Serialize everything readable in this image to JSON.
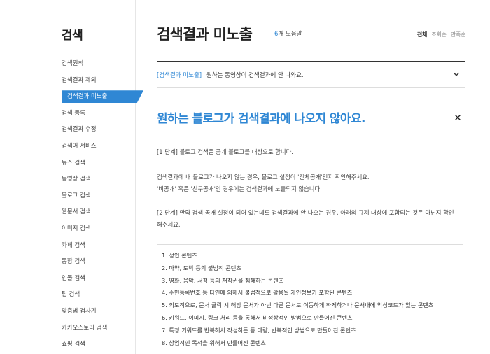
{
  "sidebar": {
    "title": "검색",
    "items": [
      {
        "label": "검색원칙",
        "active": false
      },
      {
        "label": "검색결과 제외",
        "active": false
      },
      {
        "label": "검색결과 미노출",
        "active": true
      },
      {
        "label": "검색 등록",
        "active": false
      },
      {
        "label": "검색결과 수정",
        "active": false
      },
      {
        "label": "검색어 서비스",
        "active": false
      },
      {
        "label": "뉴스 검색",
        "active": false
      },
      {
        "label": "동영상 검색",
        "active": false
      },
      {
        "label": "블로그 검색",
        "active": false
      },
      {
        "label": "웹문서 검색",
        "active": false
      },
      {
        "label": "이미지 검색",
        "active": false
      },
      {
        "label": "카페 검색",
        "active": false
      },
      {
        "label": "통합 검색",
        "active": false
      },
      {
        "label": "인물 검색",
        "active": false
      },
      {
        "label": "팁 검색",
        "active": false
      },
      {
        "label": "맞춤법 검사기",
        "active": false
      },
      {
        "label": "카카오스토리 검색",
        "active": false
      },
      {
        "label": "쇼핑 검색",
        "active": false
      }
    ]
  },
  "header": {
    "title": "검색결과 미노출",
    "help_count": "6",
    "help_suffix": "개 도움말",
    "sort": [
      "전체",
      "조회순",
      "만족순"
    ]
  },
  "faq": {
    "category": "[검색결과 미노출]",
    "question": "원하는 동영상이 검색결과에 안 나와요."
  },
  "answer": {
    "title": "원하는 블로그가 검색결과에 나오지 않아요.",
    "p1": "[1 단계] 블로그 검색은 공개 블로그를 대상으로 합니다.",
    "p2a": "검색결과에 내 블로그가 나오지 않는 경우, 블로그 설정이 '전체공개'인지 확인해주세요.",
    "p2b": "'비공개' 혹은 '친구공개'인 경우에는 검색결과에 노출되지 않습니다.",
    "p3a": "[2 단계] 만약 검색 공개 설정이 되어 있는데도 검색결과에 안 나오는 경우, 아래의 규제 대상에 포함되는 것은 아닌지 확인",
    "p3b": "해주세요.",
    "rules": [
      "1. 성인 콘텐츠",
      "2. 마약, 도박 등의 불법적 콘텐츠",
      "3. 영화, 음악, 서적 등의 저작권을 침해하는 콘텐츠",
      "4. 주민등록번호 등 타인에 의해서 불법적으로 활용될 개인정보가 포함된 콘텐츠",
      "5. 의도적으로, 문서 클릭 시 해당 문서가 아닌 다른 문서로 이동하게 하게하거나  문서내에 악성코드가 있는 콘텐츠",
      "6. 키워드, 이미지, 링크 처리 등을 통해서 비정상적인 방법으로 만들어진 콘텐츠",
      "7. 특정 키워드를 반복해서 작성하든 등 대량, 반복적인 방법으로 만들어진 콘텐츠",
      "8. 상업적인 목적을 위해서 만들어진 콘텐츠"
    ]
  },
  "icons": {
    "chevron": "chevron-down-icon",
    "close": "close-icon"
  },
  "colors": {
    "accent": "#2f87d4"
  }
}
